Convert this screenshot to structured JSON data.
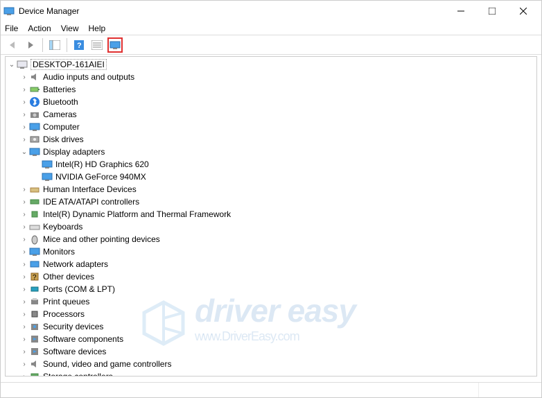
{
  "window": {
    "title": "Device Manager"
  },
  "menu": {
    "file": "File",
    "action": "Action",
    "view": "View",
    "help": "Help"
  },
  "toolbar": {
    "back": "back",
    "forward": "forward",
    "show_hide": "show-hide-console-tree",
    "help": "help",
    "action_menu": "action-menu",
    "scan": "scan-for-hardware-changes"
  },
  "root": {
    "label": "DESKTOP-161AIEI"
  },
  "categories": [
    {
      "label": "Audio inputs and outputs",
      "icon": "speaker",
      "expanded": false,
      "depth": 1
    },
    {
      "label": "Batteries",
      "icon": "battery",
      "expanded": false,
      "depth": 1
    },
    {
      "label": "Bluetooth",
      "icon": "bluetooth",
      "expanded": false,
      "depth": 1
    },
    {
      "label": "Cameras",
      "icon": "camera",
      "expanded": false,
      "depth": 1
    },
    {
      "label": "Computer",
      "icon": "monitor",
      "expanded": false,
      "depth": 1
    },
    {
      "label": "Disk drives",
      "icon": "disk",
      "expanded": false,
      "depth": 1
    },
    {
      "label": "Display adapters",
      "icon": "monitor",
      "expanded": true,
      "depth": 1,
      "children": [
        {
          "label": "Intel(R) HD Graphics 620",
          "icon": "monitor",
          "depth": 2
        },
        {
          "label": "NVIDIA GeForce 940MX",
          "icon": "monitor",
          "depth": 2
        }
      ]
    },
    {
      "label": "Human Interface Devices",
      "icon": "hid",
      "expanded": false,
      "depth": 1
    },
    {
      "label": "IDE ATA/ATAPI controllers",
      "icon": "ide",
      "expanded": false,
      "depth": 1
    },
    {
      "label": "Intel(R) Dynamic Platform and Thermal Framework",
      "icon": "chip",
      "expanded": false,
      "depth": 1
    },
    {
      "label": "Keyboards",
      "icon": "keyboard",
      "expanded": false,
      "depth": 1
    },
    {
      "label": "Mice and other pointing devices",
      "icon": "mouse",
      "expanded": false,
      "depth": 1
    },
    {
      "label": "Monitors",
      "icon": "monitor",
      "expanded": false,
      "depth": 1
    },
    {
      "label": "Network adapters",
      "icon": "network",
      "expanded": false,
      "depth": 1
    },
    {
      "label": "Other devices",
      "icon": "other",
      "expanded": false,
      "depth": 1
    },
    {
      "label": "Ports (COM & LPT)",
      "icon": "port",
      "expanded": false,
      "depth": 1
    },
    {
      "label": "Print queues",
      "icon": "printer",
      "expanded": false,
      "depth": 1
    },
    {
      "label": "Processors",
      "icon": "cpu",
      "expanded": false,
      "depth": 1
    },
    {
      "label": "Security devices",
      "icon": "security",
      "expanded": false,
      "depth": 1
    },
    {
      "label": "Software components",
      "icon": "software",
      "expanded": false,
      "depth": 1
    },
    {
      "label": "Software devices",
      "icon": "software",
      "expanded": false,
      "depth": 1
    },
    {
      "label": "Sound, video and game controllers",
      "icon": "sound",
      "expanded": false,
      "depth": 1
    },
    {
      "label": "Storage controllers",
      "icon": "storage",
      "expanded": false,
      "depth": 1
    }
  ],
  "watermark": {
    "main": "driver easy",
    "sub": "www.DriverEasy.com"
  }
}
